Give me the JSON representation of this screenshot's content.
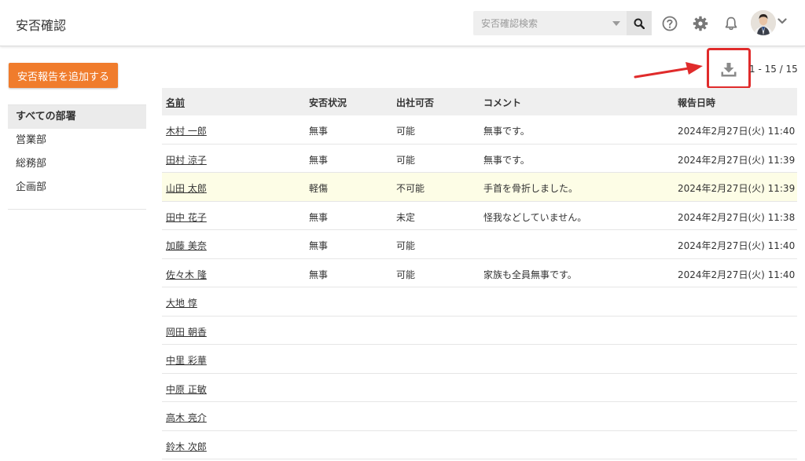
{
  "header": {
    "title": "安否確認",
    "search_placeholder": "安否確認検索",
    "icons": [
      "search-icon",
      "help-icon",
      "gear-icon",
      "bell-icon",
      "chevron-down-icon"
    ]
  },
  "sidebar": {
    "add_button": "安否報告を追加する",
    "departments": [
      {
        "label": "すべての部署",
        "active": true
      },
      {
        "label": "営業部",
        "active": false
      },
      {
        "label": "総務部",
        "active": false
      },
      {
        "label": "企画部",
        "active": false
      }
    ]
  },
  "toolbar": {
    "paging": "1 - 15 / 15",
    "download_icon": "download-icon"
  },
  "table": {
    "headers": [
      "名前",
      "安否状況",
      "出社可否",
      "コメント",
      "報告日時"
    ],
    "rows": [
      [
        "木村 一郎",
        "無事",
        "可能",
        "無事です。",
        "2024年2月27日(火) 11:40"
      ],
      [
        "田村 涼子",
        "無事",
        "可能",
        "無事です。",
        "2024年2月27日(火) 11:39"
      ],
      [
        "山田 太郎",
        "軽傷",
        "不可能",
        "手首を骨折しました。",
        "2024年2月27日(火) 11:39"
      ],
      [
        "田中 花子",
        "無事",
        "未定",
        "怪我などしていません。",
        "2024年2月27日(火) 11:38"
      ],
      [
        "加藤 美奈",
        "無事",
        "可能",
        "",
        "2024年2月27日(火) 11:40"
      ],
      [
        "佐々木 隆",
        "無事",
        "可能",
        "家族も全員無事です。",
        "2024年2月27日(火) 11:40"
      ],
      [
        "大地 惇",
        "",
        "",
        "",
        ""
      ],
      [
        "岡田 朝香",
        "",
        "",
        "",
        ""
      ],
      [
        "中里 彩華",
        "",
        "",
        "",
        ""
      ],
      [
        "中原 正敏",
        "",
        "",
        "",
        ""
      ],
      [
        "高木 亮介",
        "",
        "",
        "",
        ""
      ],
      [
        "鈴木 次郎",
        "",
        "",
        "",
        ""
      ]
    ]
  },
  "colors": {
    "accent": "#f07c2c",
    "highlight_row": "#fdfde6",
    "callout_red": "#e02b2b"
  }
}
